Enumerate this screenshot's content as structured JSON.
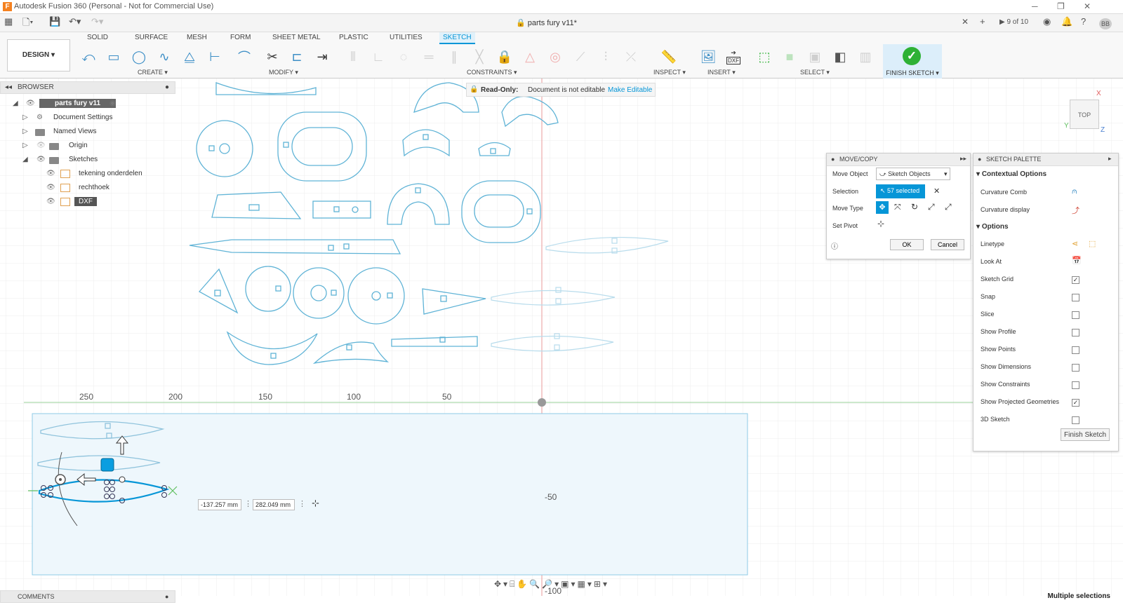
{
  "window": {
    "title": "Autodesk Fusion 360 (Personal - Not for Commercial Use)"
  },
  "tabbar": {
    "doc_title": "parts fury v11*",
    "version_counter": "9 of 10",
    "user_initials": "BB"
  },
  "ribbon": {
    "workspace": "DESIGN",
    "tabs": [
      "SOLID",
      "SURFACE",
      "MESH",
      "FORM",
      "SHEET METAL",
      "PLASTIC",
      "UTILITIES",
      "SKETCH"
    ],
    "groups": {
      "create": "CREATE",
      "modify": "MODIFY",
      "constraints": "CONSTRAINTS",
      "inspect": "INSPECT",
      "insert": "INSERT",
      "select": "SELECT",
      "finish": "FINISH SKETCH"
    },
    "insert_dxf_label": "DXF"
  },
  "browser": {
    "title": "BROWSER",
    "root": "parts fury v11",
    "items": [
      "Document Settings",
      "Named Views",
      "Origin",
      "Sketches"
    ],
    "sketches": [
      "tekening onderdelen",
      "rechthoek",
      "DXF"
    ]
  },
  "readonly": {
    "label": "Read-Only:",
    "message": "Document is not editable",
    "action": "Make Editable"
  },
  "axis": {
    "x_ticks": [
      "250",
      "200",
      "150",
      "100",
      "50"
    ],
    "y_ticks": [
      "-50",
      "-100"
    ]
  },
  "inputs": {
    "x_value": "-137.257 mm",
    "y_value": "282.049 mm"
  },
  "viewcube": {
    "label": "TOP",
    "x": "X",
    "y": "Y",
    "z": "Z"
  },
  "movecopy": {
    "title": "MOVE/COPY",
    "move_object_label": "Move Object",
    "move_object_value": "Sketch Objects",
    "selection_label": "Selection",
    "selection_value": "57 selected",
    "move_type_label": "Move Type",
    "set_pivot_label": "Set Pivot",
    "ok": "OK",
    "cancel": "Cancel"
  },
  "palette": {
    "title": "SKETCH PALETTE",
    "contextual_title": "Contextual Options",
    "contextual": [
      "Curvature Comb",
      "Curvature display"
    ],
    "options_title": "Options",
    "linetype": "Linetype",
    "look_at": "Look At",
    "options": [
      {
        "label": "Sketch Grid",
        "checked": true
      },
      {
        "label": "Snap",
        "checked": false
      },
      {
        "label": "Slice",
        "checked": false
      },
      {
        "label": "Show Profile",
        "checked": false
      },
      {
        "label": "Show Points",
        "checked": false
      },
      {
        "label": "Show Dimensions",
        "checked": false
      },
      {
        "label": "Show Constraints",
        "checked": false
      },
      {
        "label": "Show Projected Geometries",
        "checked": true
      },
      {
        "label": "3D Sketch",
        "checked": false
      }
    ],
    "finish": "Finish Sketch"
  },
  "comments": {
    "title": "COMMENTS"
  },
  "status": {
    "text": "Multiple selections"
  },
  "colors": {
    "accent": "#0696d7",
    "sketch": "#5fb3d6",
    "finish_green": "#2eb135"
  }
}
